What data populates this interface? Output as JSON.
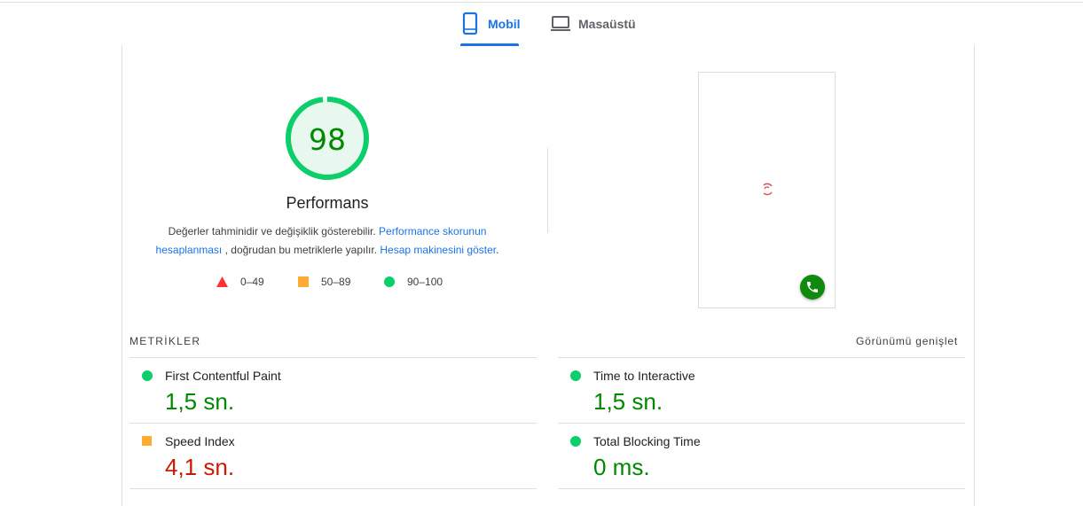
{
  "tabs": {
    "mobile": {
      "label": "Mobil",
      "icon": "smartphone-icon",
      "active": true
    },
    "desktop": {
      "label": "Masaüstü",
      "icon": "laptop-icon",
      "active": false
    }
  },
  "score": {
    "value": "98",
    "title": "Performans",
    "fraction": 0.98,
    "color": "#0cce6b"
  },
  "description": {
    "text1": "Değerler tahminidir ve değişiklik gösterebilir.",
    "link1": "Performance skorunun hesaplanması",
    "text2": ", doğrudan bu metriklerle yapılır.",
    "link2": "Hesap makinesini göster",
    "text3": "."
  },
  "legend": [
    {
      "range": "0–49",
      "shape": "triangle",
      "color": "#ff3333"
    },
    {
      "range": "50–89",
      "shape": "square",
      "color": "#ffaa33"
    },
    {
      "range": "90–100",
      "shape": "circle",
      "color": "#0cce6b"
    }
  ],
  "metrics": {
    "header": "METRİKLER",
    "expand_label": "Görünümü genişlet",
    "items": [
      {
        "label": "First Contentful Paint",
        "value": "1,5 sn.",
        "status": "pass"
      },
      {
        "label": "Time to Interactive",
        "value": "1,5 sn.",
        "status": "pass"
      },
      {
        "label": "Speed Index",
        "value": "4,1 sn.",
        "status": "average"
      },
      {
        "label": "Total Blocking Time",
        "value": "0 ms.",
        "status": "pass"
      }
    ]
  },
  "colors": {
    "accent": "#1a73e8",
    "pass": "#0cce6b",
    "pass_text": "#008800",
    "average": "#ffaa33",
    "average_text": "#cc1a00",
    "fail": "#ff3333"
  }
}
